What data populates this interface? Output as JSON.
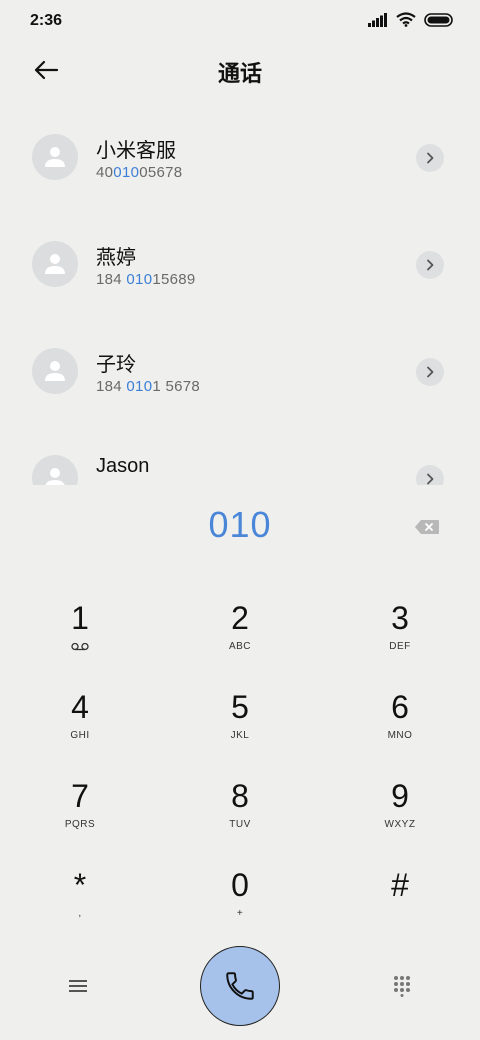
{
  "status_bar": {
    "time": "2:36"
  },
  "header": {
    "title": "通话"
  },
  "contacts": [
    {
      "name": "小米客服",
      "num_pre": "40",
      "num_hl": "010",
      "num_post": "05678"
    },
    {
      "name": "燕婷",
      "num_pre": "184 ",
      "num_hl": "010",
      "num_post": "15689"
    },
    {
      "name": "子玲",
      "num_pre": "184 ",
      "num_hl": "010",
      "num_post": "1 5678"
    },
    {
      "name": "Jason",
      "num_pre": "",
      "num_hl": "",
      "num_post": ""
    }
  ],
  "dialer": {
    "digits": "010"
  },
  "keypad": [
    {
      "digit": "1",
      "letters": ""
    },
    {
      "digit": "2",
      "letters": "ABC"
    },
    {
      "digit": "3",
      "letters": "DEF"
    },
    {
      "digit": "4",
      "letters": "GHI"
    },
    {
      "digit": "5",
      "letters": "JKL"
    },
    {
      "digit": "6",
      "letters": "MNO"
    },
    {
      "digit": "7",
      "letters": "PQRS"
    },
    {
      "digit": "8",
      "letters": "TUV"
    },
    {
      "digit": "9",
      "letters": "WXYZ"
    },
    {
      "digit": "*",
      "letters": ","
    },
    {
      "digit": "0",
      "letters": "+"
    },
    {
      "digit": "#",
      "letters": ""
    }
  ],
  "icons": {
    "voicemail": "voicemail-icon",
    "back": "arrow-left-icon",
    "call": "phone-icon",
    "menu": "hamburger-icon",
    "dialpad": "dialpad-icon",
    "backspace": "backspace-icon"
  },
  "colors": {
    "accent": "#4a86d8",
    "call_button": "#a6c2ea"
  }
}
